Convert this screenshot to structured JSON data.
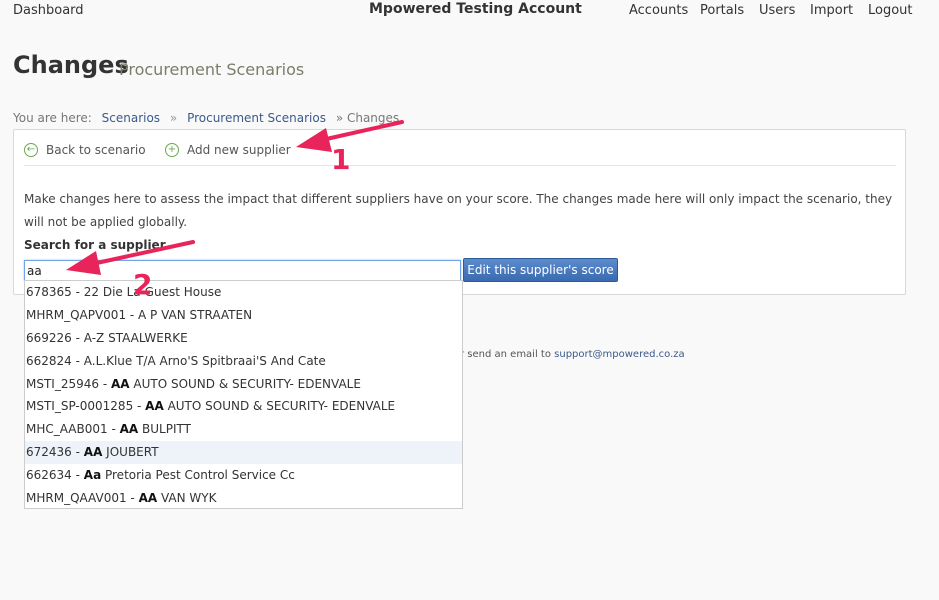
{
  "topbar": {
    "home": "Dashboard",
    "brand": "Mpowered Testing Account",
    "nav": [
      "Accounts",
      "Portals",
      "Users",
      "Import",
      "Logout"
    ]
  },
  "page": {
    "title": "Changes",
    "subtitle": "Procurement Scenarios"
  },
  "breadcrumb": {
    "prefix": "You are here:",
    "items": [
      "Scenarios",
      "Procurement Scenarios"
    ],
    "current": "» Changes",
    "separator": "»"
  },
  "actions": {
    "back": "Back to scenario",
    "add": "Add new supplier"
  },
  "description": "Make changes here to assess the impact that different suppliers have on your score. The changes made here will only impact the scenario, they will not be applied globally.",
  "search": {
    "label": "Search for a supplier",
    "value": "aa",
    "button": "Edit this supplier's score"
  },
  "support": {
    "text": "r send an email to",
    "email": "support@mpowered.co.za"
  },
  "suggestions": [
    {
      "pre": "678365 - 22 Die La",
      "match": "",
      "post": "Guest House"
    },
    {
      "pre": "MHRM_QAPV001 - A P VAN STRAATEN",
      "match": "",
      "post": ""
    },
    {
      "pre": "669226 - A-Z STAALWERKE",
      "match": "",
      "post": ""
    },
    {
      "pre": "662824 - A.L.Klue T/A Arno'S Spitbraai'S And Cate",
      "match": "",
      "post": ""
    },
    {
      "pre": "MSTI_25946 - ",
      "match": "AA",
      "post": " AUTO SOUND & SECURITY- EDENVALE"
    },
    {
      "pre": "MSTI_SP-0001285 - ",
      "match": "AA",
      "post": " AUTO SOUND & SECURITY- EDENVALE"
    },
    {
      "pre": "MHC_AAB001 - ",
      "match": "AA",
      "post": " BULPITT"
    },
    {
      "pre": "672436 - ",
      "match": "AA",
      "post": " JOUBERT"
    },
    {
      "pre": "662634 - ",
      "match": "Aa",
      "post": " Pretoria Pest Control Service Cc"
    },
    {
      "pre": "MHRM_QAAV001 - ",
      "match": "AA",
      "post": " VAN WYK"
    }
  ],
  "annotations": [
    "1",
    "2"
  ],
  "colors": {
    "annotation": "#e8245a",
    "link": "#3b5a8a",
    "button": "#3b6ab0",
    "icon": "#6aa84f"
  },
  "icons": {
    "back": "arrow-left-circle-icon",
    "add": "plus-circle-icon"
  }
}
